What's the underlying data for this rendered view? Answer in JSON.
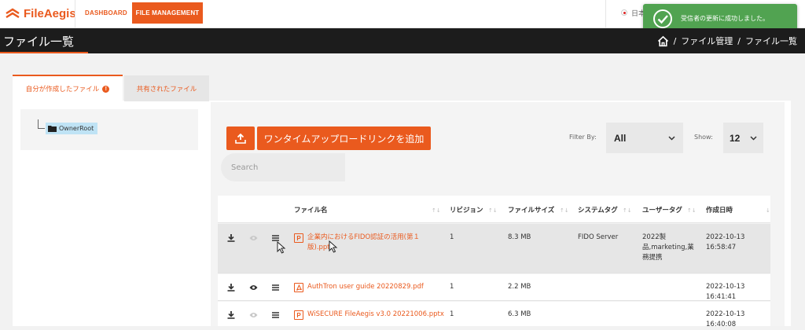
{
  "brand": {
    "name": "FileAegis",
    "accent": "#ea5a1e"
  },
  "nav": {
    "dashboard": "DASHBOARD",
    "file_management": "FILE MANAGEMENT",
    "language": "日本"
  },
  "toast": {
    "message": "受信者の更新に成功しました。",
    "color": "#51a351"
  },
  "page": {
    "title": "ファイル一覧",
    "breadcrumb": {
      "separator": "/",
      "items": [
        "ファイル管理",
        "ファイル一覧"
      ]
    }
  },
  "tabs": [
    {
      "label": "自分が作成したファイル",
      "active": true,
      "icon": "info-icon"
    },
    {
      "label": "共有されたファイル",
      "active": false
    }
  ],
  "tree": {
    "root": "OwnerRoot"
  },
  "toolbar": {
    "onetime_button": "ワンタイムアップロードリンクを追加",
    "filter_label": "Filter By:",
    "filter_value": "All",
    "show_label": "Show:",
    "show_value": "12"
  },
  "search": {
    "placeholder": "Search",
    "value": ""
  },
  "table": {
    "columns": [
      "ファイル名",
      "リビジョン",
      "ファイルサイズ",
      "システムタグ",
      "ユーザータグ",
      "作成日時"
    ],
    "rows": [
      {
        "file_name": "企業内におけるFIDO認証の活用(第１版).pptx",
        "file_type": "P",
        "revision": "1",
        "size": "8.3 MB",
        "system_tag": "FIDO Server",
        "user_tag": "2022製品,marketing,業務提携",
        "created": "2022-10-13 16:58:47",
        "highlighted": true,
        "preview_enabled": false
      },
      {
        "file_name": "AuthTron user guide 20220829.pdf",
        "file_type": "pdf",
        "revision": "1",
        "size": "2.2 MB",
        "system_tag": "",
        "user_tag": "",
        "created": "2022-10-13 16:41:41",
        "highlighted": false,
        "preview_enabled": true
      },
      {
        "file_name": "WiSECURE FileAegis v3.0 20221006.pptx",
        "file_type": "P",
        "revision": "1",
        "size": "6.3 MB",
        "system_tag": "",
        "user_tag": "",
        "created": "2022-10-13 16:40:08",
        "highlighted": false,
        "preview_enabled": false
      }
    ]
  }
}
